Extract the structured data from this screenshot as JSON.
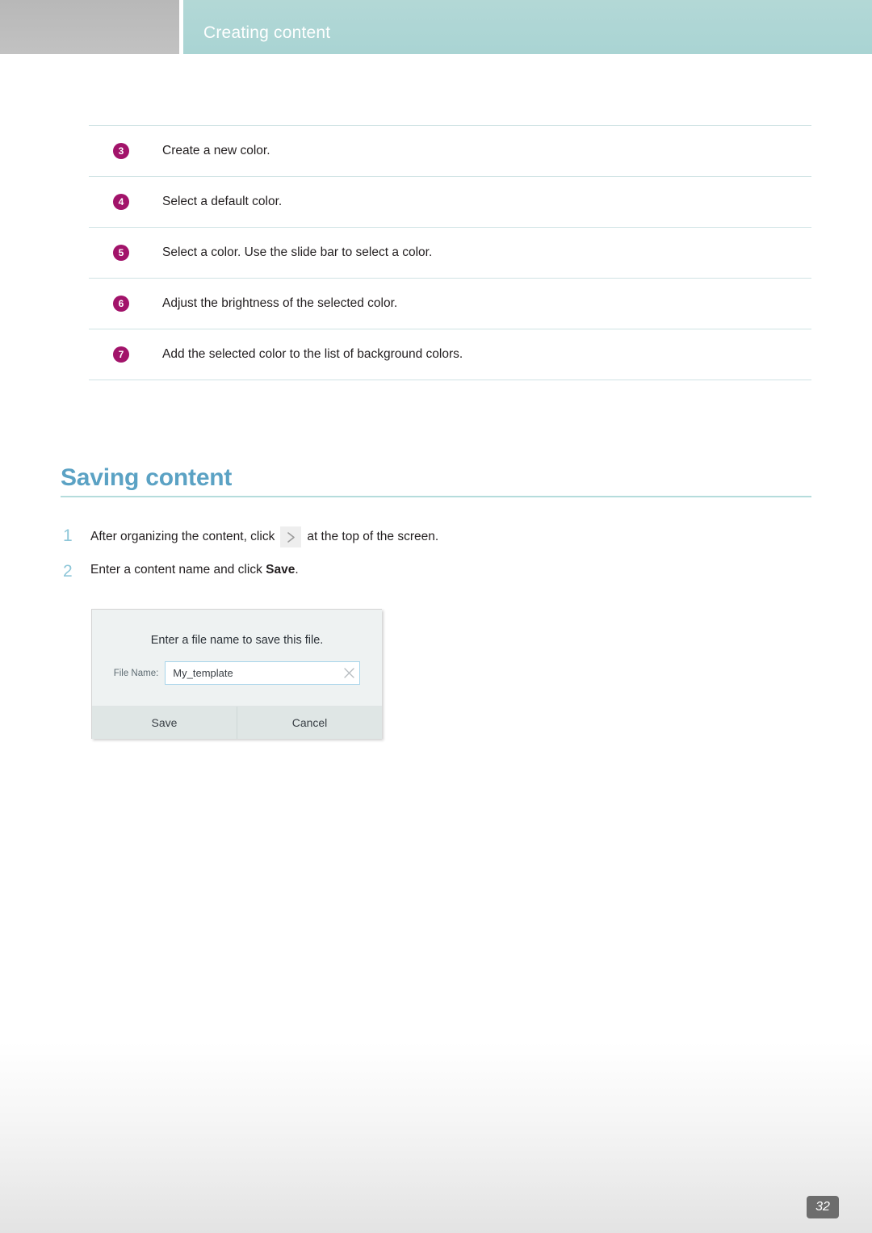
{
  "header": {
    "title": "Creating content",
    "teal_color": "#aed6d5",
    "gray_color": "#bdbdbd",
    "title_color": "#ffffff"
  },
  "step_table": {
    "badge_color": "#a2136a",
    "rule_color": "#cfe3e4",
    "rows": [
      {
        "number": "3",
        "text": "Create a new color."
      },
      {
        "number": "4",
        "text": "Select a default color."
      },
      {
        "number": "5",
        "text": "Select a color. Use the slide bar to select a color."
      },
      {
        "number": "6",
        "text": "Adjust the brightness of the selected color."
      },
      {
        "number": "7",
        "text": "Add the selected color to the list of background colors."
      }
    ]
  },
  "section": {
    "heading": "Saving content",
    "heading_color": "#5ba2c4",
    "rule_color": "#b5dcdc"
  },
  "procedure": {
    "number_color": "#8dc6d8",
    "steps": [
      {
        "number": "1",
        "text_before": "After organizing the content, click",
        "icon": "chevron-right-icon",
        "text_after": "at the top of the screen.",
        "bold": "",
        "text_end": ""
      },
      {
        "number": "2",
        "text_before": "Enter a content name and click",
        "icon": "",
        "text_after": "",
        "bold": "Save",
        "text_end": "."
      }
    ]
  },
  "save_dialog": {
    "prompt": "Enter a file name to save this file.",
    "field_label": "File Name:",
    "field_value": "My_template",
    "field_placeholder": "My_template",
    "clear_icon": "clear-x-icon",
    "buttons": [
      {
        "label": "Save"
      },
      {
        "label": "Cancel"
      }
    ],
    "background_color": "#eef2f2",
    "input_border_color": "#a7d4ea",
    "button_bar_color": "#dfe6e5"
  },
  "footer": {
    "page_number": "32",
    "badge_color": "#6d6d6d"
  }
}
